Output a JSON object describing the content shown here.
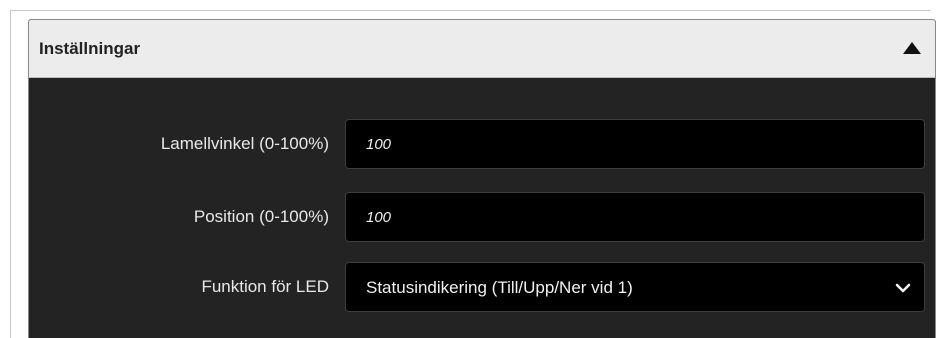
{
  "panel": {
    "title": "Inställningar",
    "collapse_icon": "triangle-up-icon"
  },
  "fields": [
    {
      "label": "Lamellvinkel (0-100%)",
      "value": "100"
    },
    {
      "label": "Position (0-100%)",
      "value": "100"
    },
    {
      "label": "Funktion för LED",
      "selected": "Statusindikering (Till/Upp/Ner vid 1)",
      "icon": "chevron-down-icon"
    }
  ]
}
